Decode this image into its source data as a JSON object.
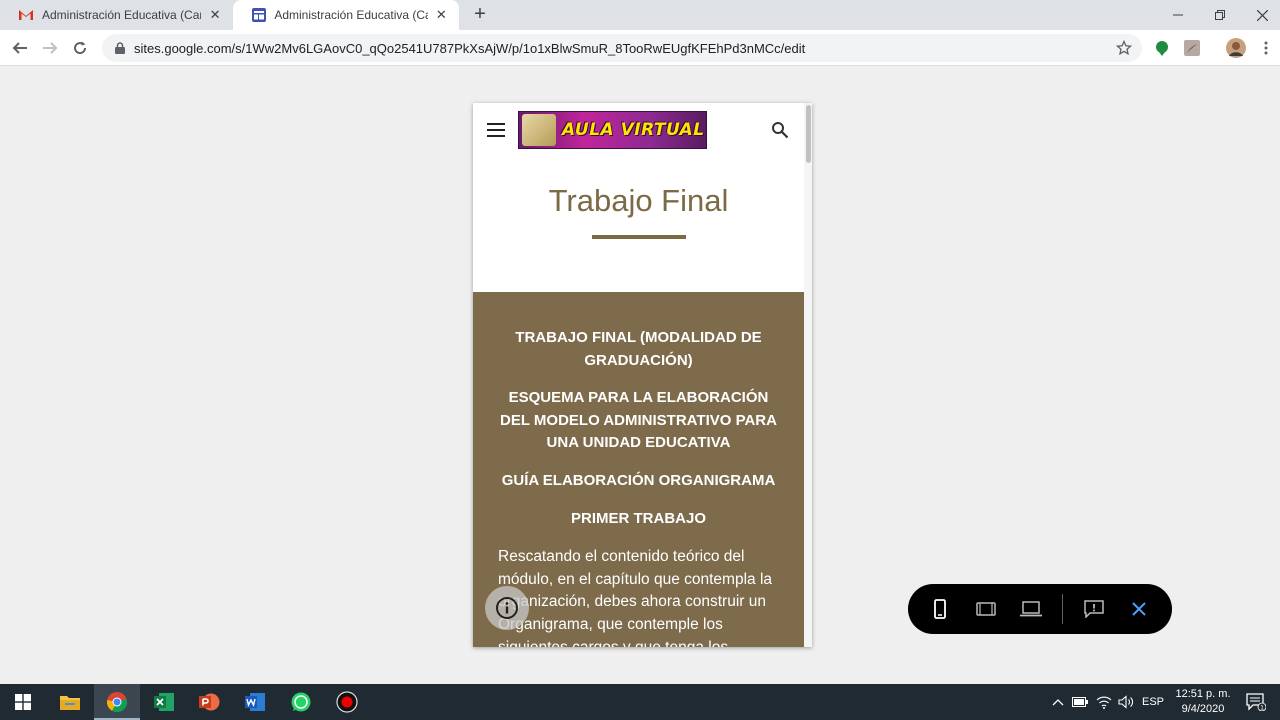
{
  "browser": {
    "tabs": [
      {
        "title": "Administración Educativa (Campo",
        "icon": "gmail-icon",
        "active": false
      },
      {
        "title": "Administración Educativa (Campo",
        "icon": "google-sites-icon",
        "active": true
      }
    ],
    "url": "sites.google.com/s/1Ww2Mv6LGAovC0_qQo2541U787PkXsAjW/p/1o1xBlwSmuR_8TooRwEUgfKFEhPd3nMCc/edit"
  },
  "site": {
    "logo_text": "AULA VIRTUAL",
    "page_title": "Trabajo Final",
    "headings": [
      "TRABAJO FINAL (MODALIDAD DE GRADUACIÓN)",
      "ESQUEMA PARA LA ELABORACIÓN DEL MODELO ADMINISTRATIVO PARA UNA UNIDAD EDUCATIVA",
      "GUÍA ELABORACIÓN ORGANIGRAMA",
      "PRIMER TRABAJO"
    ],
    "paragraph": "Rescatando el contenido teórico del módulo, en el capítulo que contempla la organización, debes ahora construir un Organigrama, que contemple los siguientes cargos y que tenga los"
  },
  "colors": {
    "accent": "#7d6b4b",
    "title": "#7c6a45"
  },
  "preview_toolbar": {
    "buttons": [
      "phone-icon",
      "tablet-icon",
      "laptop-icon",
      "feedback-icon",
      "close-icon"
    ]
  },
  "taskbar": {
    "apps": [
      "file-explorer-icon",
      "chrome-icon",
      "excel-icon",
      "powerpoint-icon",
      "word-icon",
      "whatsapp-icon",
      "recorder-icon"
    ],
    "language": "ESP",
    "time": "12:51 p. m.",
    "date": "9/4/2020",
    "notification_count": "1"
  }
}
